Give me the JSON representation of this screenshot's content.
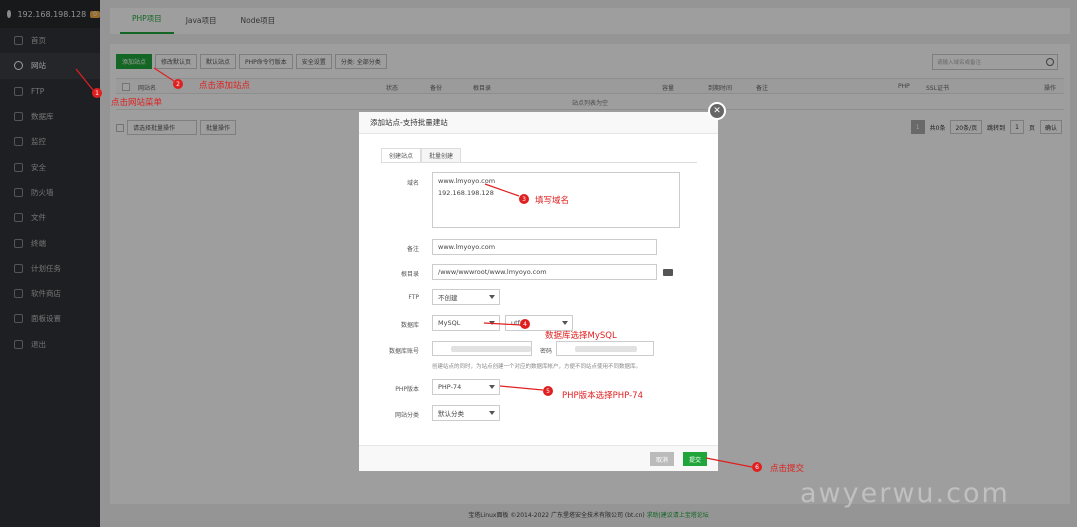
{
  "sidebar": {
    "server_ip": "192.168.198.128",
    "badge": "0",
    "items": [
      {
        "label": "首页",
        "icon": "home-icon"
      },
      {
        "label": "网站",
        "icon": "globe-icon"
      },
      {
        "label": "FTP",
        "icon": "ftp-icon"
      },
      {
        "label": "数据库",
        "icon": "database-icon"
      },
      {
        "label": "监控",
        "icon": "monitor-icon"
      },
      {
        "label": "安全",
        "icon": "shield-icon"
      },
      {
        "label": "防火墙",
        "icon": "firewall-icon"
      },
      {
        "label": "文件",
        "icon": "folder-icon"
      },
      {
        "label": "终端",
        "icon": "terminal-icon"
      },
      {
        "label": "计划任务",
        "icon": "clock-icon"
      },
      {
        "label": "软件商店",
        "icon": "store-icon"
      },
      {
        "label": "面板设置",
        "icon": "settings-icon"
      },
      {
        "label": "退出",
        "icon": "logout-icon"
      }
    ]
  },
  "top_tabs": [
    "PHP项目",
    "Java项目",
    "Node项目"
  ],
  "toolbar": {
    "buttons": [
      "添加站点",
      "修改默认页",
      "默认站点",
      "PHP命令行版本",
      "安全设置",
      "分类: 全部分类"
    ]
  },
  "search": {
    "placeholder": "请输入域名或备注"
  },
  "table": {
    "headers": [
      "网站名",
      "状态",
      "备份",
      "根目录",
      "容量",
      "到期时间",
      "备注",
      "PHP",
      "SSL证书",
      "操作"
    ],
    "empty_text": "站点列表为空"
  },
  "batch": {
    "select": "请选择批量操作",
    "button": "批量操作"
  },
  "pager": {
    "page": "1",
    "total": "共0条",
    "per_page": "20条/页",
    "goto": "跳转到",
    "goto_page": "1",
    "page_unit": "页",
    "confirm": "确认"
  },
  "modal": {
    "title": "添加站点-支持批量建站",
    "tabs": [
      "创建站点",
      "批量创建"
    ],
    "domain_label": "域名",
    "domain_lines": [
      "www.lmyoyo.com",
      "192.168.198.128"
    ],
    "remark_label": "备注",
    "remark_value": "www.lmyoyo.com",
    "root_label": "根目录",
    "root_value": "/www/wwwroot/www.lmyoyo.com",
    "ftp_label": "FTP",
    "ftp_value": "不创建",
    "db_label": "数据库",
    "db_value": "MySQL",
    "db_charset": "utf8",
    "db_account_label": "数据库账号",
    "db_password_label": "密码",
    "db_hint": "创建站点的同时，为站点创建一个对应的数据库帐户，方便不同站点使用不同数据库。",
    "php_label": "PHP版本",
    "php_value": "PHP-74",
    "category_label": "网站分类",
    "category_value": "默认分类",
    "cancel": "取消",
    "submit": "提交"
  },
  "footer": {
    "text": "宝塔Linux面板 ©2014-2022 广东堡塔安全技术有限公司 (bt.cn)",
    "link": "求助|建议请上宝塔论坛"
  },
  "annotations": {
    "a1": "点击网站菜单",
    "a2": "点击添加站点",
    "a3": "填写域名",
    "a4": "数据库选择MySQL",
    "a5": "PHP版本选择PHP-74",
    "a6": "点击提交",
    "n1": "1",
    "n2": "2",
    "n3": "3",
    "n4": "4",
    "n5": "5",
    "n6": "6"
  },
  "watermark": "awyerwu.com",
  "colors": {
    "accent": "#20a53a",
    "annotation": "#e02020",
    "sidebar": "#2f3237"
  }
}
